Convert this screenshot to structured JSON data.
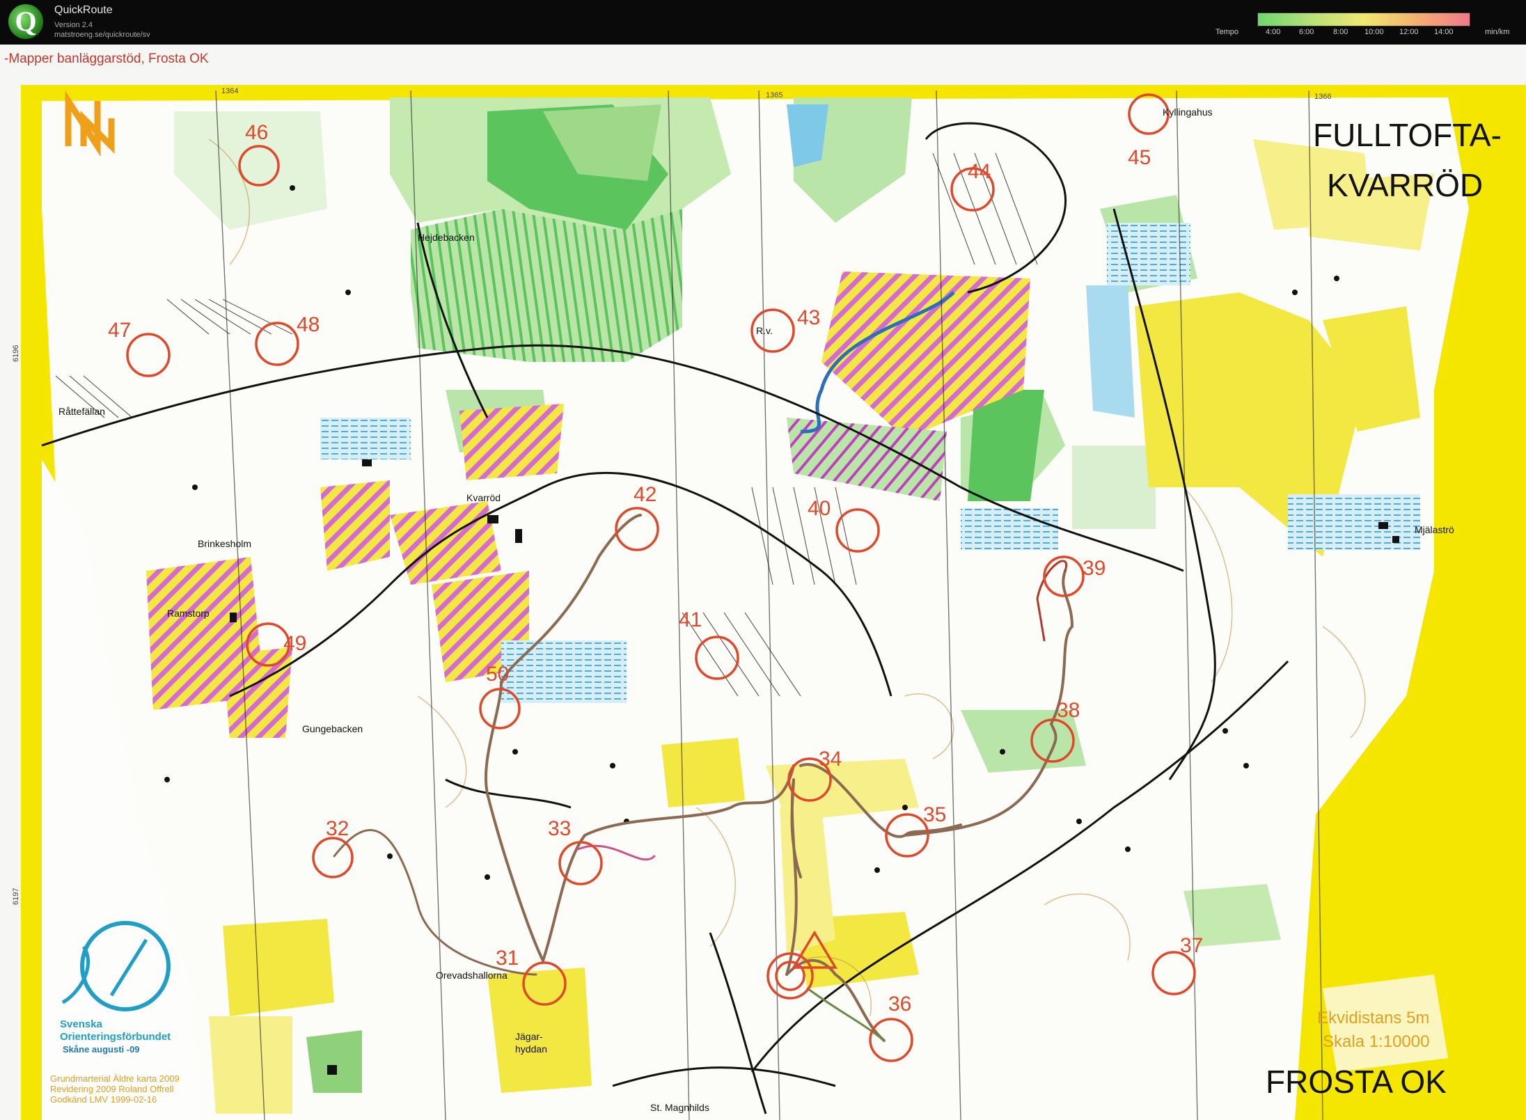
{
  "app": {
    "name": "QuickRoute",
    "version": "Version 2.4",
    "url": "matstroeng.se/quickroute/sv",
    "logo_letter": "Q"
  },
  "tempo_legend": {
    "label": "Tempo",
    "ticks": [
      "4:00",
      "6:00",
      "8:00",
      "10:00",
      "12:00",
      "14:00"
    ],
    "unit": "min/km"
  },
  "map": {
    "header_credit": "-Mapper banläggarstöd, Frosta OK",
    "title_line1": "FULLTOFTA-",
    "title_line2": "KVARRÖD",
    "club": "FROSTA OK",
    "equidistance": "Ekvidistans 5m",
    "scale": "Skala 1:10000",
    "grid_labels": [
      "1364",
      "1365",
      "1366",
      "6196",
      "6197"
    ],
    "federation_name": "Svenska",
    "federation_name2": "Orienteringsförbundet",
    "federation_region": "Skåne   augusti -09",
    "credits": [
      "Grundmarterial Äldre karta 2009",
      "Revidering 2009  Roland Offrell",
      "Godkänd LMV  1999-02-16"
    ],
    "place_names": [
      "Kyllingahus",
      "Hejdebacken",
      "Råttefällan",
      "Kvarröd",
      "Brinkesholm",
      "Ramstorp",
      "Gungebacken",
      "Mjälaströ",
      "Orevadshallorna",
      "Jägar-",
      "hyddan",
      "St. Magnhilds",
      "R.v."
    ],
    "controls": [
      "46",
      "47",
      "48",
      "43",
      "44",
      "45",
      "42",
      "40",
      "39",
      "41",
      "49",
      "50",
      "34",
      "38",
      "35",
      "32",
      "33",
      "31",
      "37",
      "36"
    ],
    "colors": {
      "frame": "#f5e600",
      "forest_green": "#5cc45c",
      "light_green": "#b9e6a8",
      "open_yellow": "#f3e842",
      "course_red": "#e0482a",
      "route": "#8c6a52",
      "water_blue": "#7ec8e8",
      "restricted": "#c040c0"
    }
  }
}
